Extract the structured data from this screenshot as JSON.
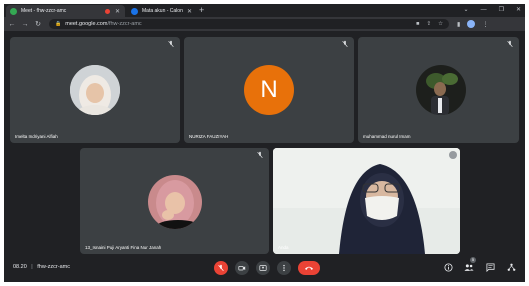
{
  "browser": {
    "tabs": [
      {
        "title": "Meet - fhw-zzcr-amc",
        "favicon_color": "#34a853",
        "active": true,
        "recording": true,
        "close": "✕"
      },
      {
        "title": "Mata akun - Calon",
        "favicon_color": "#1a73e8",
        "active": false,
        "close": "✕"
      }
    ],
    "new_tab": "+",
    "url_host": "meet.google.com",
    "url_path": "/fhw-zzcr-amc"
  },
  "participants": [
    {
      "name": "Imelta Indriyani Alfiah",
      "muted": true,
      "avatar": "photo"
    },
    {
      "name": "NURIZA FAUZIYAH",
      "muted": true,
      "avatar": "letter",
      "initial": "N",
      "avatar_color": "#e8710a"
    },
    {
      "name": "muhammad nurul Imam",
      "muted": true,
      "avatar": "photo"
    },
    {
      "name": "13_Isnaini Puji Aryanti Fina Nur Janah",
      "muted": true,
      "avatar": "photo"
    },
    {
      "name": "Anda",
      "muted": false,
      "avatar": "camera"
    }
  ],
  "meeting": {
    "time": "08.20",
    "separator": "|",
    "code": "fhw-zzcr-amc",
    "participant_count": "5"
  },
  "colors": {
    "stage_bg": "#202124",
    "tile_bg": "#3c4043",
    "accent_red": "#ea4335",
    "tab_active": "#35363a"
  }
}
